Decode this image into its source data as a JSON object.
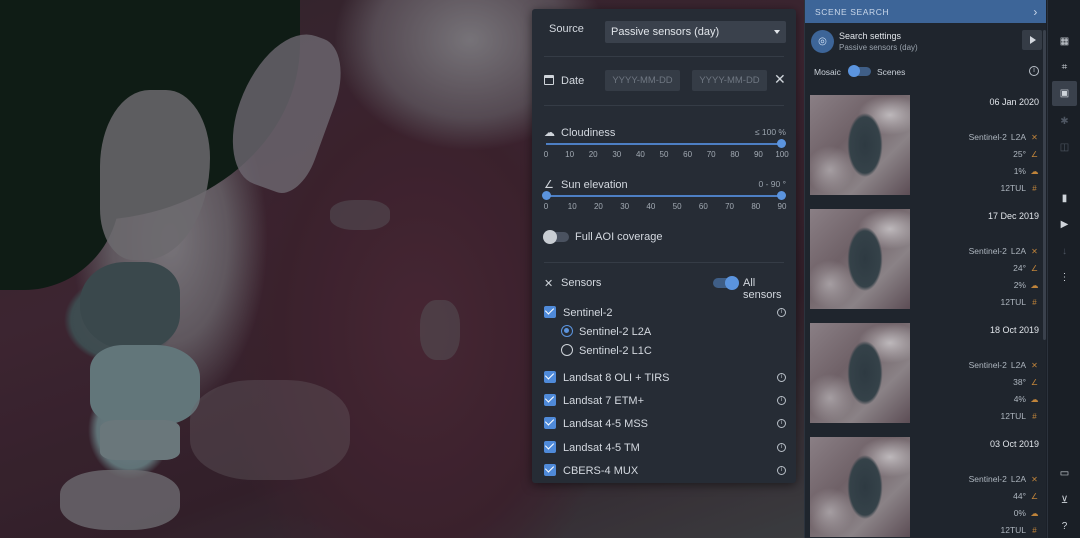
{
  "filters": {
    "source_label": "Source",
    "source_value": "Passive sensors (day)",
    "date_label": "Date",
    "date_from_placeholder": "YYYY-MM-DD",
    "date_to_placeholder": "YYYY-MM-DD",
    "cloudiness": {
      "label": "Cloudiness",
      "value_text": "≤ 100 %",
      "max": 100,
      "ticks": [
        "0",
        "10",
        "20",
        "30",
        "40",
        "50",
        "60",
        "70",
        "80",
        "90",
        "100"
      ]
    },
    "sun_elevation": {
      "label": "Sun elevation",
      "value_text": "0 - 90 °",
      "min": 0,
      "max": 90,
      "ticks": [
        "0",
        "10",
        "20",
        "30",
        "40",
        "50",
        "60",
        "70",
        "80",
        "90"
      ]
    },
    "full_aoi_label": "Full AOI coverage",
    "full_aoi_on": false,
    "sensors_label": "Sensors",
    "all_sensors_label": "All sensors",
    "all_sensors_on": true,
    "sensors": [
      {
        "name": "Sentinel-2",
        "checked": true
      },
      {
        "name": "Landsat 8 OLI + TIRS",
        "checked": true
      },
      {
        "name": "Landsat 7 ETM+",
        "checked": true
      },
      {
        "name": "Landsat 4-5 MSS",
        "checked": true
      },
      {
        "name": "Landsat 4-5 TM",
        "checked": true
      },
      {
        "name": "CBERS-4 MUX",
        "checked": true
      }
    ],
    "sentinel_levels": [
      {
        "name": "Sentinel-2 L2A",
        "selected": true
      },
      {
        "name": "Sentinel-2 L1C",
        "selected": false
      }
    ]
  },
  "scene_search": {
    "title": "SCENE SEARCH",
    "settings_title": "Search settings",
    "settings_sub": "Passive sensors (day)",
    "mosaic_label": "Mosaic",
    "scenes_label": "Scenes",
    "results": [
      {
        "date": "06 Jan 2020",
        "sensor": "Sentinel-2",
        "level": "L2A",
        "sun": "25°",
        "cloud": "1%",
        "tile": "12TUL"
      },
      {
        "date": "17 Dec 2019",
        "sensor": "Sentinel-2",
        "level": "L2A",
        "sun": "24°",
        "cloud": "2%",
        "tile": "12TUL"
      },
      {
        "date": "18 Oct 2019",
        "sensor": "Sentinel-2",
        "level": "L2A",
        "sun": "38°",
        "cloud": "4%",
        "tile": "12TUL"
      },
      {
        "date": "03 Oct 2019",
        "sensor": "Sentinel-2",
        "level": "L2A",
        "sun": "44°",
        "cloud": "0%",
        "tile": "12TUL"
      }
    ]
  },
  "toolbar_icons": [
    "layers-icon",
    "aoi-crop-icon",
    "image-icon",
    "settings-icon",
    "compare-icon",
    "chart-icon",
    "timelapse-icon",
    "download-icon",
    "more-icon",
    "comment-icon",
    "cart-icon",
    "help-icon"
  ],
  "colors": {
    "accent": "#5b94de",
    "header": "#3d6598",
    "panel": "#262c35"
  }
}
